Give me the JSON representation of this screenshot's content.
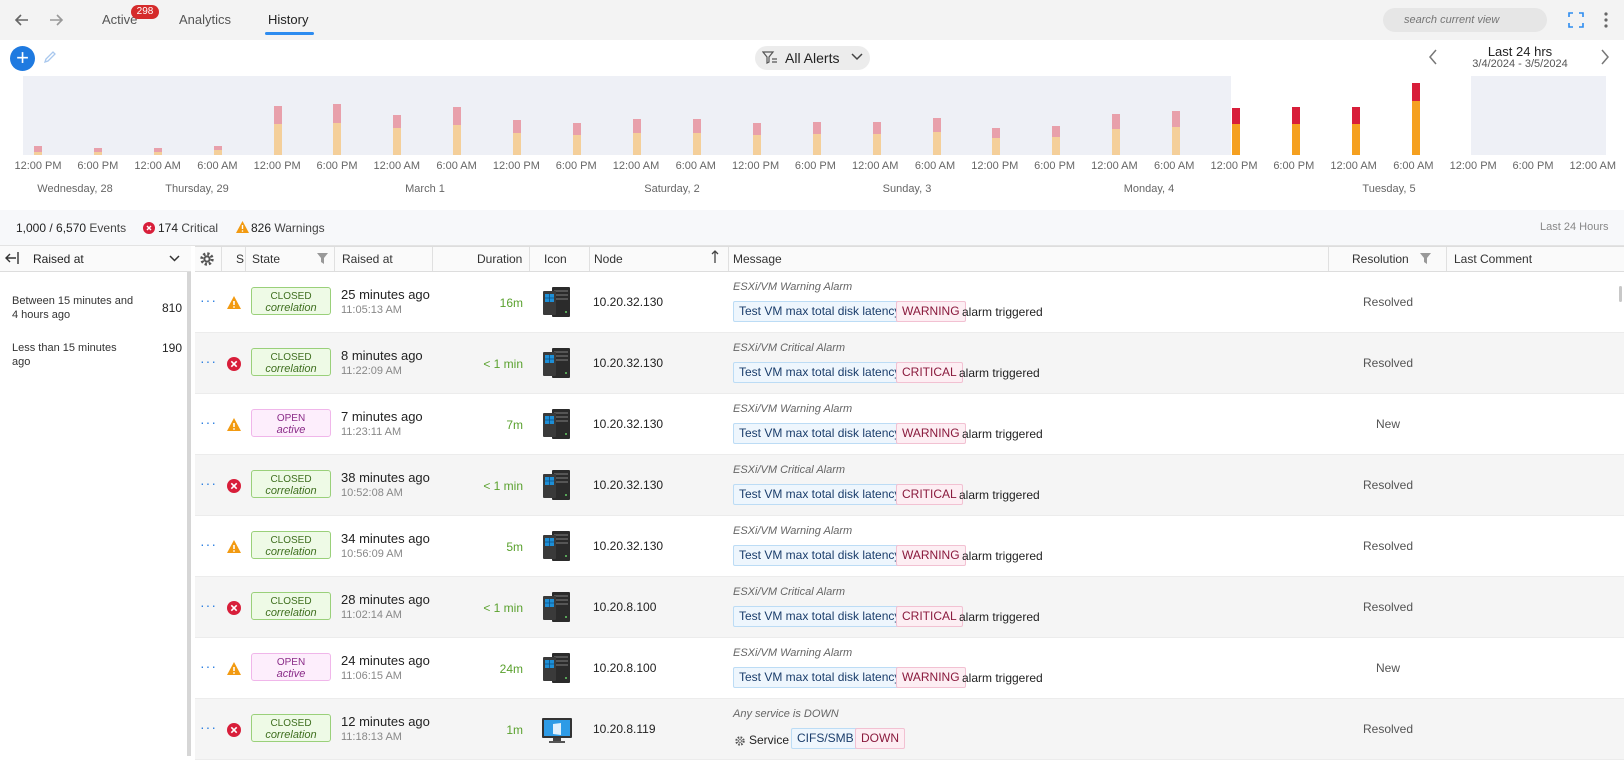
{
  "nav": {
    "tabs": [
      {
        "label": "Active",
        "badge": "298"
      },
      {
        "label": "Analytics"
      },
      {
        "label": "History"
      }
    ],
    "active_tab": "History",
    "search_placeholder": "search current view"
  },
  "toolbar": {
    "filter_label": "All Alerts",
    "range_title": "Last 24 hrs",
    "range_dates": "3/4/2024 - 3/5/2024"
  },
  "timeline": {
    "ticks": [
      "12:00 PM",
      "6:00 PM",
      "12:00 AM",
      "6:00 AM",
      "12:00 PM",
      "6:00 PM",
      "12:00 AM",
      "6:00 AM",
      "12:00 PM",
      "6:00 PM",
      "12:00 AM",
      "6:00 AM",
      "12:00 PM",
      "6:00 PM",
      "12:00 AM",
      "6:00 AM",
      "12:00 PM",
      "6:00 PM",
      "12:00 AM",
      "6:00 AM",
      "12:00 PM",
      "6:00 PM",
      "12:00 AM",
      "6:00 AM",
      "12:00 PM",
      "6:00 PM",
      "12:00 AM"
    ],
    "days": [
      "Wednesday, 28",
      "Thursday, 29",
      "March 1",
      "Saturday, 2",
      "Sunday, 3",
      "Monday, 4",
      "Tuesday, 5"
    ],
    "colors": {
      "warning_dim": "#f4cf9a",
      "critical_dim": "#e8a0ab",
      "warning": "#f5a020",
      "critical": "#d81e3a",
      "bg": "#eef0f6"
    }
  },
  "summary": {
    "events": "1,000 / 6,570",
    "events_label": "Events",
    "critical": "174",
    "critical_label": "Critical",
    "warnings": "826",
    "warnings_label": "Warnings",
    "period": "Last 24 Hours"
  },
  "left_panel": {
    "group_by": "Raised at",
    "groups": [
      {
        "label": "Between 15 minutes and 4 hours ago",
        "count": "810"
      },
      {
        "label": "Less than 15 minutes ago",
        "count": "190"
      }
    ]
  },
  "columns": {
    "s": "S",
    "state": "State",
    "raised_at": "Raised at",
    "duration": "Duration",
    "icon": "Icon",
    "node": "Node",
    "message": "Message",
    "resolution": "Resolution",
    "last_comment": "Last Comment"
  },
  "rows": [
    {
      "severity": "warning",
      "state": "CLOSED",
      "state_sub": "correlation",
      "raised_rel": "25 minutes ago",
      "raised_abs": "11:05:13 AM",
      "duration": "16m",
      "node_type": "server",
      "node": "10.20.32.130",
      "msg_title": "ESXi/VM Warning Alarm",
      "tag1": "Test VM max total disk latency",
      "tag2": "WARNING",
      "tail": "alarm triggered",
      "resolution": "Resolved"
    },
    {
      "severity": "critical",
      "state": "CLOSED",
      "state_sub": "correlation",
      "raised_rel": "8 minutes ago",
      "raised_abs": "11:22:09 AM",
      "duration": "< 1 min",
      "node_type": "server",
      "node": "10.20.32.130",
      "msg_title": "ESXi/VM Critical Alarm",
      "tag1": "Test VM max total disk latency",
      "tag2": "CRITICAL",
      "tail": "alarm triggered",
      "resolution": "Resolved"
    },
    {
      "severity": "warning",
      "state": "OPEN",
      "state_sub": "active",
      "raised_rel": "7 minutes ago",
      "raised_abs": "11:23:11 AM",
      "duration": "7m",
      "node_type": "server",
      "node": "10.20.32.130",
      "msg_title": "ESXi/VM Warning Alarm",
      "tag1": "Test VM max total disk latency",
      "tag2": "WARNING",
      "tail": "alarm triggered",
      "resolution": "New"
    },
    {
      "severity": "critical",
      "state": "CLOSED",
      "state_sub": "correlation",
      "raised_rel": "38 minutes ago",
      "raised_abs": "10:52:08 AM",
      "duration": "< 1 min",
      "node_type": "server",
      "node": "10.20.32.130",
      "msg_title": "ESXi/VM Critical Alarm",
      "tag1": "Test VM max total disk latency",
      "tag2": "CRITICAL",
      "tail": "alarm triggered",
      "resolution": "Resolved"
    },
    {
      "severity": "warning",
      "state": "CLOSED",
      "state_sub": "correlation",
      "raised_rel": "34 minutes ago",
      "raised_abs": "10:56:09 AM",
      "duration": "5m",
      "node_type": "server",
      "node": "10.20.32.130",
      "msg_title": "ESXi/VM Warning Alarm",
      "tag1": "Test VM max total disk latency",
      "tag2": "WARNING",
      "tail": "alarm triggered",
      "resolution": "Resolved"
    },
    {
      "severity": "critical",
      "state": "CLOSED",
      "state_sub": "correlation",
      "raised_rel": "28 minutes ago",
      "raised_abs": "11:02:14 AM",
      "duration": "< 1 min",
      "node_type": "server",
      "node": "10.20.8.100",
      "msg_title": "ESXi/VM Critical Alarm",
      "tag1": "Test VM max total disk latency",
      "tag2": "CRITICAL",
      "tail": "alarm triggered",
      "resolution": "Resolved"
    },
    {
      "severity": "warning",
      "state": "OPEN",
      "state_sub": "active",
      "raised_rel": "24 minutes ago",
      "raised_abs": "11:06:15 AM",
      "duration": "24m",
      "node_type": "server",
      "node": "10.20.8.100",
      "msg_title": "ESXi/VM Warning Alarm",
      "tag1": "Test VM max total disk latency",
      "tag2": "WARNING",
      "tail": "alarm triggered",
      "resolution": "New"
    },
    {
      "severity": "critical",
      "state": "CLOSED",
      "state_sub": "correlation",
      "raised_rel": "12 minutes ago",
      "raised_abs": "11:18:13 AM",
      "duration": "1m",
      "node_type": "desktop",
      "node": "10.20.8.119",
      "msg_title": "Any service is DOWN",
      "service_label": "Service",
      "tag1": "CIFS/SMB",
      "tag2": "DOWN",
      "tail": "",
      "resolution": "Resolved"
    }
  ]
}
